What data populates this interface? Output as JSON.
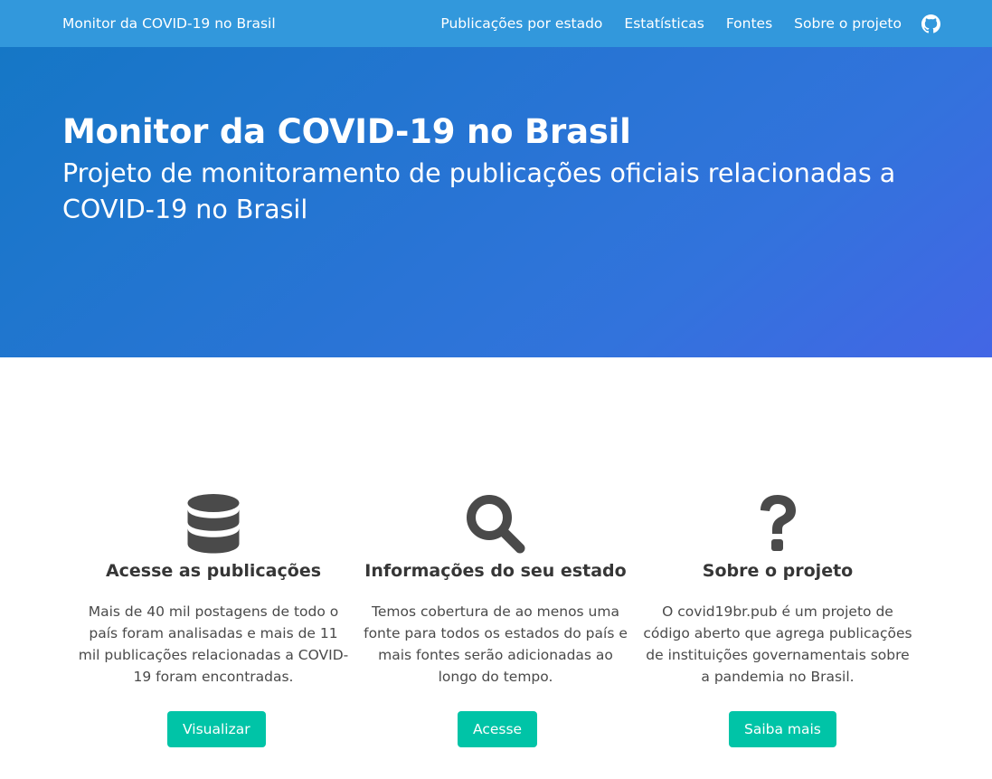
{
  "navbar": {
    "brand": "Monitor da COVID-19 no Brasil",
    "links": [
      {
        "label": "Publicações por estado"
      },
      {
        "label": "Estatísticas"
      },
      {
        "label": "Fontes"
      },
      {
        "label": "Sobre o projeto"
      }
    ],
    "github_icon": "github-icon"
  },
  "hero": {
    "title": "Monitor da COVID-19 no Brasil",
    "subtitle": "Projeto de monitoramento de publicações oficiais relacionadas a COVID-19 no Brasil",
    "gradient_colors": [
      "#1577c6",
      "#3273dc",
      "#4366e5"
    ]
  },
  "features": [
    {
      "icon": "database-icon",
      "title": "Acesse as publicações",
      "text": "Mais de 40 mil postagens de todo o país foram analisadas e mais de 11 mil publicações relacionadas a COVID-19 foram encontradas.",
      "button": "Visualizar"
    },
    {
      "icon": "search-icon",
      "title": "Informações do seu estado",
      "text": "Temos cobertura de ao menos uma fonte para todos os estados do país e mais fontes serão adicionadas ao longo do tempo.",
      "button": "Acesse"
    },
    {
      "icon": "question-icon",
      "title": "Sobre o projeto",
      "text": "O covid19br.pub é um projeto de código aberto que agrega publicações de instituições governamentais sobre a pandemia no Brasil.",
      "button": "Saiba mais"
    }
  ],
  "colors": {
    "navbar": "#3298dc",
    "button": "#00c4a7",
    "icon": "#4a4a4a"
  }
}
